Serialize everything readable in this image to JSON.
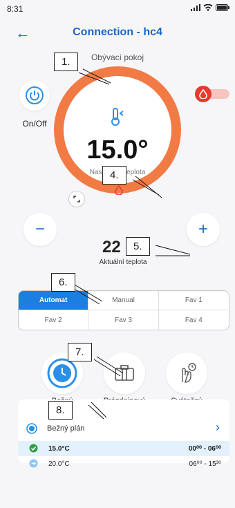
{
  "status": {
    "time": "8:31"
  },
  "header": {
    "title": "Connection - hc4"
  },
  "room": "Obývací pokoj",
  "power": {
    "label": "On/Off"
  },
  "target": {
    "value": "15.0°",
    "label": "Nastavená teplota"
  },
  "actual": {
    "value": "22",
    "label": "Aktuální teplota"
  },
  "modes": [
    {
      "label": "Automat",
      "active": true
    },
    {
      "label": "Manual"
    },
    {
      "label": "Fav 1"
    },
    {
      "label": "Fav 2"
    },
    {
      "label": "Fav 3"
    },
    {
      "label": "Fav 4"
    }
  ],
  "schedules": [
    {
      "label": "Bežný",
      "icon": "clock-icon"
    },
    {
      "label": "Prázdninový",
      "icon": "luggage-icon"
    },
    {
      "label": "Svátečný",
      "icon": "hand-clock-icon"
    }
  ],
  "program": {
    "title": "Bežný plán",
    "rows": [
      {
        "temp": "15.0°C",
        "time": "00⁰⁰ - 06⁰⁰",
        "active": true
      },
      {
        "temp": "20.0°C",
        "time": "06⁰⁰ - 15³⁰"
      }
    ]
  },
  "callouts": [
    "1.",
    "4.",
    "5.",
    "6.",
    "7.",
    "8."
  ],
  "colors": {
    "accent": "#1a66c9",
    "ring": "#f27a45",
    "flame": "#e53b2f"
  }
}
